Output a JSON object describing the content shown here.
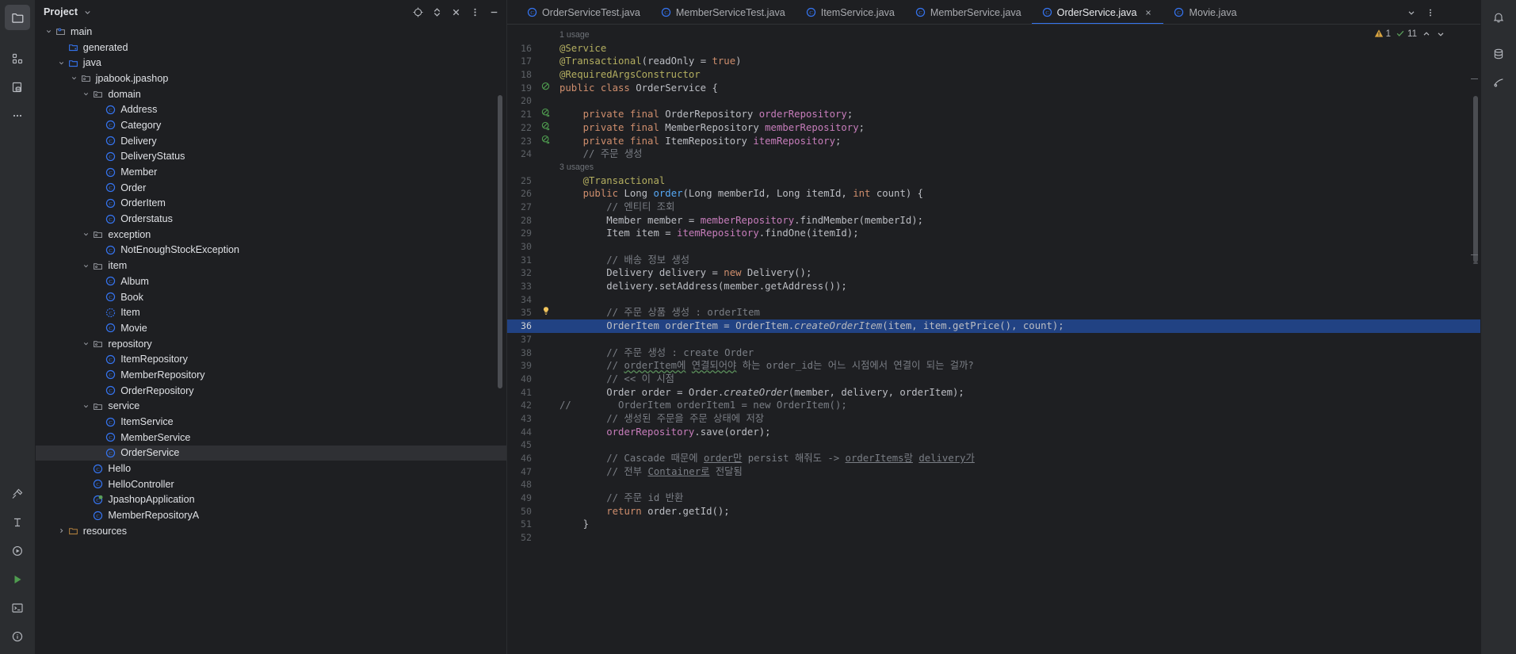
{
  "activity_bar": {
    "top_items": [
      {
        "name": "project-tool-window",
        "icon": "folder-icon",
        "active": true
      },
      {
        "name": "structure-tool-window",
        "icon": "structure-icon",
        "active": false
      },
      {
        "name": "database-tool-window",
        "icon": "database-icon",
        "active": false
      },
      {
        "name": "more-tool-windows",
        "icon": "ellipsis-icon",
        "active": false
      }
    ],
    "bottom_items": [
      {
        "name": "build-tool-window",
        "icon": "hammer-icon"
      },
      {
        "name": "profiler-tool-window",
        "icon": "profiler-icon"
      },
      {
        "name": "run-tool-window",
        "icon": "run-icon"
      },
      {
        "name": "services-tool-window",
        "icon": "play-triangle-icon"
      },
      {
        "name": "terminal-tool-window",
        "icon": "terminal-icon"
      },
      {
        "name": "problems-tool-window",
        "icon": "info-circle-icon"
      }
    ]
  },
  "project_panel": {
    "title": "Project",
    "actions": [
      {
        "name": "locate-file-button",
        "icon": "crosshair-icon"
      },
      {
        "name": "expand-collapse-button",
        "icon": "chevron-updown-icon"
      },
      {
        "name": "close-panel-button",
        "icon": "close-x-icon"
      },
      {
        "name": "panel-options-button",
        "icon": "vertical-dots-icon"
      },
      {
        "name": "hide-panel-button",
        "icon": "minus-icon"
      }
    ],
    "tree": [
      {
        "label": "main",
        "indent": 3,
        "icon": "module-folder-icon",
        "twisty": "down",
        "selected": false
      },
      {
        "label": "generated",
        "indent": 4,
        "icon": "generated-folder-icon",
        "twisty": "none",
        "selected": false
      },
      {
        "label": "java",
        "indent": 4,
        "icon": "source-folder-icon",
        "twisty": "down",
        "selected": false
      },
      {
        "label": "jpabook.jpashop",
        "indent": 5,
        "icon": "package-icon",
        "twisty": "down",
        "selected": false
      },
      {
        "label": "domain",
        "indent": 6,
        "icon": "package-icon",
        "twisty": "down",
        "selected": false
      },
      {
        "label": "Address",
        "indent": 7,
        "icon": "class-icon",
        "twisty": "none",
        "selected": false
      },
      {
        "label": "Category",
        "indent": 7,
        "icon": "class-icon",
        "twisty": "none",
        "selected": false
      },
      {
        "label": "Delivery",
        "indent": 7,
        "icon": "class-icon",
        "twisty": "none",
        "selected": false
      },
      {
        "label": "DeliveryStatus",
        "indent": 7,
        "icon": "class-icon",
        "twisty": "none",
        "selected": false
      },
      {
        "label": "Member",
        "indent": 7,
        "icon": "class-icon",
        "twisty": "none",
        "selected": false
      },
      {
        "label": "Order",
        "indent": 7,
        "icon": "class-icon",
        "twisty": "none",
        "selected": false
      },
      {
        "label": "OrderItem",
        "indent": 7,
        "icon": "class-icon",
        "twisty": "none",
        "selected": false
      },
      {
        "label": "Orderstatus",
        "indent": 7,
        "icon": "class-icon",
        "twisty": "none",
        "selected": false
      },
      {
        "label": "exception",
        "indent": 6,
        "icon": "package-icon",
        "twisty": "down",
        "selected": false
      },
      {
        "label": "NotEnoughStockException",
        "indent": 7,
        "icon": "class-icon",
        "twisty": "none",
        "selected": false
      },
      {
        "label": "item",
        "indent": 6,
        "icon": "package-icon",
        "twisty": "down",
        "selected": false
      },
      {
        "label": "Album",
        "indent": 7,
        "icon": "class-icon",
        "twisty": "none",
        "selected": false
      },
      {
        "label": "Book",
        "indent": 7,
        "icon": "class-icon",
        "twisty": "none",
        "selected": false
      },
      {
        "label": "Item",
        "indent": 7,
        "icon": "abstract-class-icon",
        "twisty": "none",
        "selected": false
      },
      {
        "label": "Movie",
        "indent": 7,
        "icon": "class-icon",
        "twisty": "none",
        "selected": false
      },
      {
        "label": "repository",
        "indent": 6,
        "icon": "package-icon",
        "twisty": "down",
        "selected": false
      },
      {
        "label": "ItemRepository",
        "indent": 7,
        "icon": "class-icon",
        "twisty": "none",
        "selected": false
      },
      {
        "label": "MemberRepository",
        "indent": 7,
        "icon": "class-icon",
        "twisty": "none",
        "selected": false
      },
      {
        "label": "OrderRepository",
        "indent": 7,
        "icon": "class-icon",
        "twisty": "none",
        "selected": false
      },
      {
        "label": "service",
        "indent": 6,
        "icon": "package-icon",
        "twisty": "down",
        "selected": false
      },
      {
        "label": "ItemService",
        "indent": 7,
        "icon": "class-icon",
        "twisty": "none",
        "selected": false
      },
      {
        "label": "MemberService",
        "indent": 7,
        "icon": "class-icon",
        "twisty": "none",
        "selected": false
      },
      {
        "label": "OrderService",
        "indent": 7,
        "icon": "class-icon",
        "twisty": "none",
        "selected": true
      },
      {
        "label": "Hello",
        "indent": 6,
        "icon": "class-icon",
        "twisty": "none",
        "selected": false
      },
      {
        "label": "HelloController",
        "indent": 6,
        "icon": "class-icon",
        "twisty": "none",
        "selected": false
      },
      {
        "label": "JpashopApplication",
        "indent": 6,
        "icon": "spring-class-icon",
        "twisty": "none",
        "selected": false
      },
      {
        "label": "MemberRepositoryA",
        "indent": 6,
        "icon": "class-icon",
        "twisty": "none",
        "selected": false
      },
      {
        "label": "resources",
        "indent": 4,
        "icon": "resources-folder-icon",
        "twisty": "right",
        "selected": false
      }
    ]
  },
  "editor": {
    "tabs": [
      {
        "label": "OrderServiceTest.java",
        "icon": "class-icon",
        "active": false,
        "closable": false
      },
      {
        "label": "MemberServiceTest.java",
        "icon": "class-icon",
        "active": false,
        "closable": false
      },
      {
        "label": "ItemService.java",
        "icon": "class-icon",
        "active": false,
        "closable": false
      },
      {
        "label": "MemberService.java",
        "icon": "class-icon",
        "active": false,
        "closable": false
      },
      {
        "label": "OrderService.java",
        "icon": "class-icon",
        "active": true,
        "closable": true
      },
      {
        "label": "Movie.java",
        "icon": "class-icon",
        "active": false,
        "closable": false
      }
    ],
    "tab_controls": [
      {
        "name": "tab-list-button",
        "icon": "chevron-down-icon"
      },
      {
        "name": "tab-options-button",
        "icon": "vertical-dots-icon"
      }
    ],
    "inspections": {
      "warning_count": "1",
      "ok_count": "11",
      "warning_icon": "warning-triangle-icon",
      "ok_icon": "checkmark-icon",
      "prev_icon": "chevron-up-icon",
      "next_icon": "chevron-down-icon"
    },
    "highlighted_line": 36,
    "lines": [
      {
        "num": "",
        "kind": "anno",
        "text": "1 usage"
      },
      {
        "num": "16",
        "kind": "code",
        "mark": "",
        "tokens": [
          [
            "an",
            "@Service"
          ]
        ]
      },
      {
        "num": "17",
        "kind": "code",
        "mark": "",
        "tokens": [
          [
            "an",
            "@Transactional"
          ],
          [
            "tx",
            "("
          ],
          [
            "tx",
            "readOnly = "
          ],
          [
            "k",
            "true"
          ],
          [
            "tx",
            ")"
          ]
        ]
      },
      {
        "num": "18",
        "kind": "code",
        "mark": "",
        "tokens": [
          [
            "an",
            "@RequiredArgsConstructor"
          ]
        ]
      },
      {
        "num": "19",
        "kind": "code",
        "mark": "impl",
        "tokens": [
          [
            "k",
            "public class "
          ],
          [
            "tx",
            "OrderService {"
          ]
        ]
      },
      {
        "num": "20",
        "kind": "code",
        "mark": "",
        "tokens": []
      },
      {
        "num": "21",
        "kind": "code",
        "mark": "impl-arrow",
        "tokens": [
          [
            "tx",
            "    "
          ],
          [
            "k",
            "private final "
          ],
          [
            "tx",
            "OrderRepository "
          ],
          [
            "fd",
            "orderRepository"
          ],
          [
            "tx",
            ";"
          ]
        ]
      },
      {
        "num": "22",
        "kind": "code",
        "mark": "impl-arrow",
        "tokens": [
          [
            "tx",
            "    "
          ],
          [
            "k",
            "private final "
          ],
          [
            "tx",
            "MemberRepository "
          ],
          [
            "fd",
            "memberRepository"
          ],
          [
            "tx",
            ";"
          ]
        ]
      },
      {
        "num": "23",
        "kind": "code",
        "mark": "impl-arrow",
        "tokens": [
          [
            "tx",
            "    "
          ],
          [
            "k",
            "private final "
          ],
          [
            "tx",
            "ItemRepository "
          ],
          [
            "fd",
            "itemRepository"
          ],
          [
            "tx",
            ";"
          ]
        ]
      },
      {
        "num": "24",
        "kind": "code",
        "mark": "",
        "tokens": [
          [
            "cm",
            "    // 주문 생성"
          ]
        ]
      },
      {
        "num": "",
        "kind": "anno",
        "text": "3 usages"
      },
      {
        "num": "25",
        "kind": "code",
        "mark": "",
        "tokens": [
          [
            "tx",
            "    "
          ],
          [
            "an",
            "@Transactional"
          ]
        ]
      },
      {
        "num": "26",
        "kind": "code",
        "mark": "",
        "tokens": [
          [
            "tx",
            "    "
          ],
          [
            "k",
            "public "
          ],
          [
            "tx",
            "Long "
          ],
          [
            "mt",
            "order"
          ],
          [
            "tx",
            "(Long memberId, Long itemId, "
          ],
          [
            "k",
            "int"
          ],
          [
            "tx",
            " count) {"
          ]
        ]
      },
      {
        "num": "27",
        "kind": "code",
        "mark": "",
        "tokens": [
          [
            "cm",
            "        // 엔티티 조회"
          ]
        ]
      },
      {
        "num": "28",
        "kind": "code",
        "mark": "",
        "tokens": [
          [
            "tx",
            "        Member member = "
          ],
          [
            "fd",
            "memberRepository"
          ],
          [
            "tx",
            ".findMember(memberId);"
          ]
        ]
      },
      {
        "num": "29",
        "kind": "code",
        "mark": "",
        "tokens": [
          [
            "tx",
            "        Item item = "
          ],
          [
            "fd",
            "itemRepository"
          ],
          [
            "tx",
            ".findOne(itemId);"
          ]
        ]
      },
      {
        "num": "30",
        "kind": "code",
        "mark": "",
        "tokens": []
      },
      {
        "num": "31",
        "kind": "code",
        "mark": "",
        "tokens": [
          [
            "cm",
            "        // 배송 정보 생성"
          ]
        ]
      },
      {
        "num": "32",
        "kind": "code",
        "mark": "",
        "tokens": [
          [
            "tx",
            "        Delivery delivery = "
          ],
          [
            "k",
            "new "
          ],
          [
            "tx",
            "Delivery();"
          ]
        ]
      },
      {
        "num": "33",
        "kind": "code",
        "mark": "",
        "tokens": [
          [
            "tx",
            "        delivery.setAddress(member.getAddress());"
          ]
        ]
      },
      {
        "num": "34",
        "kind": "code",
        "mark": "",
        "tokens": []
      },
      {
        "num": "35",
        "kind": "code",
        "mark": "bulb",
        "tokens": [
          [
            "cm",
            "        // 주문 상품 생성 : orderItem"
          ]
        ]
      },
      {
        "num": "36",
        "kind": "code",
        "mark": "",
        "highlight": true,
        "tokens": [
          [
            "tx",
            "        OrderItem orderItem = OrderItem."
          ],
          [
            "sm",
            "createOrderItem"
          ],
          [
            "tx",
            "(item, item.getPrice(), count);"
          ]
        ]
      },
      {
        "num": "37",
        "kind": "code",
        "mark": "",
        "tokens": []
      },
      {
        "num": "38",
        "kind": "code",
        "mark": "",
        "tokens": [
          [
            "cm",
            "        // 주문 생성 : create Order"
          ]
        ]
      },
      {
        "num": "39",
        "kind": "code",
        "mark": "",
        "tokens": [
          [
            "cm",
            "        // orderItem에 연결되어야 하는 order_id는 어느 시점에서 연결이 되는 걸까?"
          ]
        ]
      },
      {
        "num": "40",
        "kind": "code",
        "mark": "",
        "tokens": [
          [
            "cm",
            "        // << 이 시점"
          ]
        ]
      },
      {
        "num": "41",
        "kind": "code",
        "mark": "",
        "tokens": [
          [
            "tx",
            "        Order order = Order."
          ],
          [
            "sm",
            "createOrder"
          ],
          [
            "tx",
            "(member, delivery, orderItem);"
          ]
        ]
      },
      {
        "num": "42",
        "kind": "code",
        "mark": "",
        "tokens": [
          [
            "cm",
            "//        OrderItem orderItem1 = new OrderItem();"
          ]
        ]
      },
      {
        "num": "43",
        "kind": "code",
        "mark": "",
        "tokens": [
          [
            "cm",
            "        // 생성된 주문을 주문 상태에 저장"
          ]
        ]
      },
      {
        "num": "44",
        "kind": "code",
        "mark": "",
        "tokens": [
          [
            "tx",
            "        "
          ],
          [
            "fd",
            "orderRepository"
          ],
          [
            "tx",
            ".save(order);"
          ]
        ]
      },
      {
        "num": "45",
        "kind": "code",
        "mark": "",
        "tokens": []
      },
      {
        "num": "46",
        "kind": "code",
        "mark": "",
        "tokens": [
          [
            "cm",
            "        // Cascade 때문에 order만 persist 해줘도 -> orderItems랑 delivery가"
          ]
        ]
      },
      {
        "num": "47",
        "kind": "code",
        "mark": "",
        "tokens": [
          [
            "cm",
            "        // 전부 Container로 전달됨"
          ]
        ]
      },
      {
        "num": "48",
        "kind": "code",
        "mark": "",
        "tokens": []
      },
      {
        "num": "49",
        "kind": "code",
        "mark": "",
        "tokens": [
          [
            "cm",
            "        // 주문 id 반환"
          ]
        ]
      },
      {
        "num": "50",
        "kind": "code",
        "mark": "",
        "tokens": [
          [
            "tx",
            "        "
          ],
          [
            "k",
            "return "
          ],
          [
            "tx",
            "order.getId();"
          ]
        ]
      },
      {
        "num": "51",
        "kind": "code",
        "mark": "",
        "tokens": [
          [
            "tx",
            "    }"
          ]
        ]
      },
      {
        "num": "52",
        "kind": "code",
        "mark": "",
        "tokens": []
      }
    ]
  },
  "right_bar": {
    "items": [
      {
        "name": "notifications-button",
        "icon": "bell-icon"
      },
      {
        "name": "database-right-button",
        "icon": "database-icon"
      },
      {
        "name": "gradle-right-button",
        "icon": "gradle-icon"
      }
    ]
  },
  "colors": {
    "accent": "#3574f0",
    "selection": "#214283",
    "panel_bg": "#1e1f22",
    "bar_bg": "#2b2d30",
    "text": "#dfe1e5",
    "keyword": "#cf8e6d",
    "annotation": "#b3ae60",
    "comment": "#7a7e85",
    "field": "#c77dbb",
    "method": "#56a8f5"
  }
}
